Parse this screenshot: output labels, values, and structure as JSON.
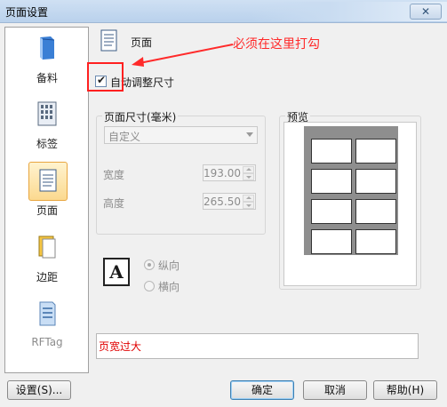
{
  "window": {
    "title": "页面设置"
  },
  "sidebar": {
    "items": [
      {
        "label": "备料",
        "icon": "book-icon"
      },
      {
        "label": "标签",
        "icon": "barcode-grid-icon"
      },
      {
        "label": "页面",
        "icon": "page-icon"
      },
      {
        "label": "边距",
        "icon": "margin-icon"
      },
      {
        "label": "RFTag",
        "icon": "rftag-icon"
      }
    ],
    "active": "页面"
  },
  "header": {
    "title": "页面"
  },
  "annotation": {
    "text": "必须在这里打勾",
    "color": "#ff2a2a"
  },
  "auto_size": {
    "label": "自动调整尺寸",
    "checked": true
  },
  "page_size": {
    "legend": "页面尺寸(毫米)",
    "preset": "自定义",
    "width_label": "宽度",
    "width_value": "193.00",
    "height_label": "高度",
    "height_value": "265.50"
  },
  "orientation": {
    "icon_letter": "A",
    "portrait_label": "纵向",
    "landscape_label": "横向",
    "selected": "纵向"
  },
  "preview": {
    "legend": "预览"
  },
  "status": {
    "text": "页宽过大",
    "color": "#e00000"
  },
  "buttons": {
    "settings": "设置(S)...",
    "ok": "确定",
    "cancel": "取消",
    "help": "帮助(H)"
  }
}
